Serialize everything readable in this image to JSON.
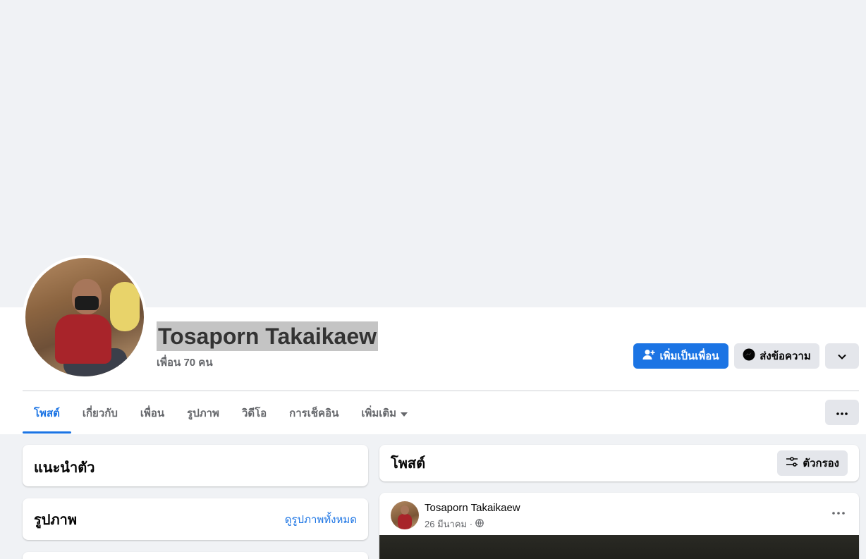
{
  "profile": {
    "name": "Tosaporn Takaikaew",
    "friends_count": "เพื่อน 70 คน"
  },
  "actions": {
    "add_friend": "เพิ่มเป็นเพื่อน",
    "message": "ส่งข้อความ"
  },
  "tabs": [
    {
      "label": "โพสต์",
      "active": true
    },
    {
      "label": "เกี่ยวกับ"
    },
    {
      "label": "เพื่อน"
    },
    {
      "label": "รูปภาพ"
    },
    {
      "label": "วิดีโอ"
    },
    {
      "label": "การเช็คอิน"
    },
    {
      "label": "เพิ่มเติม"
    }
  ],
  "left": {
    "intro_title": "แนะนำตัว",
    "photos_title": "รูปภาพ",
    "see_all_photos": "ดูรูปภาพทั้งหมด"
  },
  "posts": {
    "title": "โพสต์",
    "filter_label": "ตัวกรอง",
    "items": [
      {
        "author": "Tosaporn Takaikaew",
        "date": "26 มีนาคม ·"
      }
    ]
  },
  "colors": {
    "accent": "#1b74e4",
    "background": "#f0f2f5",
    "button_gray": "#e4e6eb"
  }
}
